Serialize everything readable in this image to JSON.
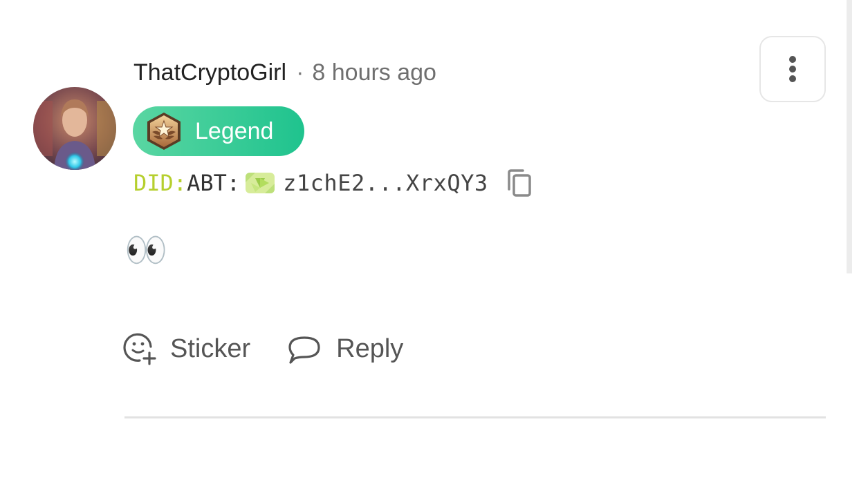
{
  "comment": {
    "author": "ThatCryptoGirl",
    "separator": "·",
    "timestamp": "8 hours ago",
    "badge": {
      "label": "Legend",
      "color_start": "#5ad6a2",
      "color_end": "#1fc38e",
      "icon": "medal-icon"
    },
    "did": {
      "prefix": "DID:",
      "chain": "ABT:",
      "address": "z1chE2...XrxQY3",
      "prefix_color": "#b6cf2e"
    },
    "body": "👀",
    "actions": {
      "sticker_label": "Sticker",
      "reply_label": "Reply"
    }
  },
  "icons": {
    "more": "more-vertical-icon",
    "copy": "copy-icon",
    "sticker": "sticker-add-icon",
    "reply": "speech-bubble-icon"
  }
}
